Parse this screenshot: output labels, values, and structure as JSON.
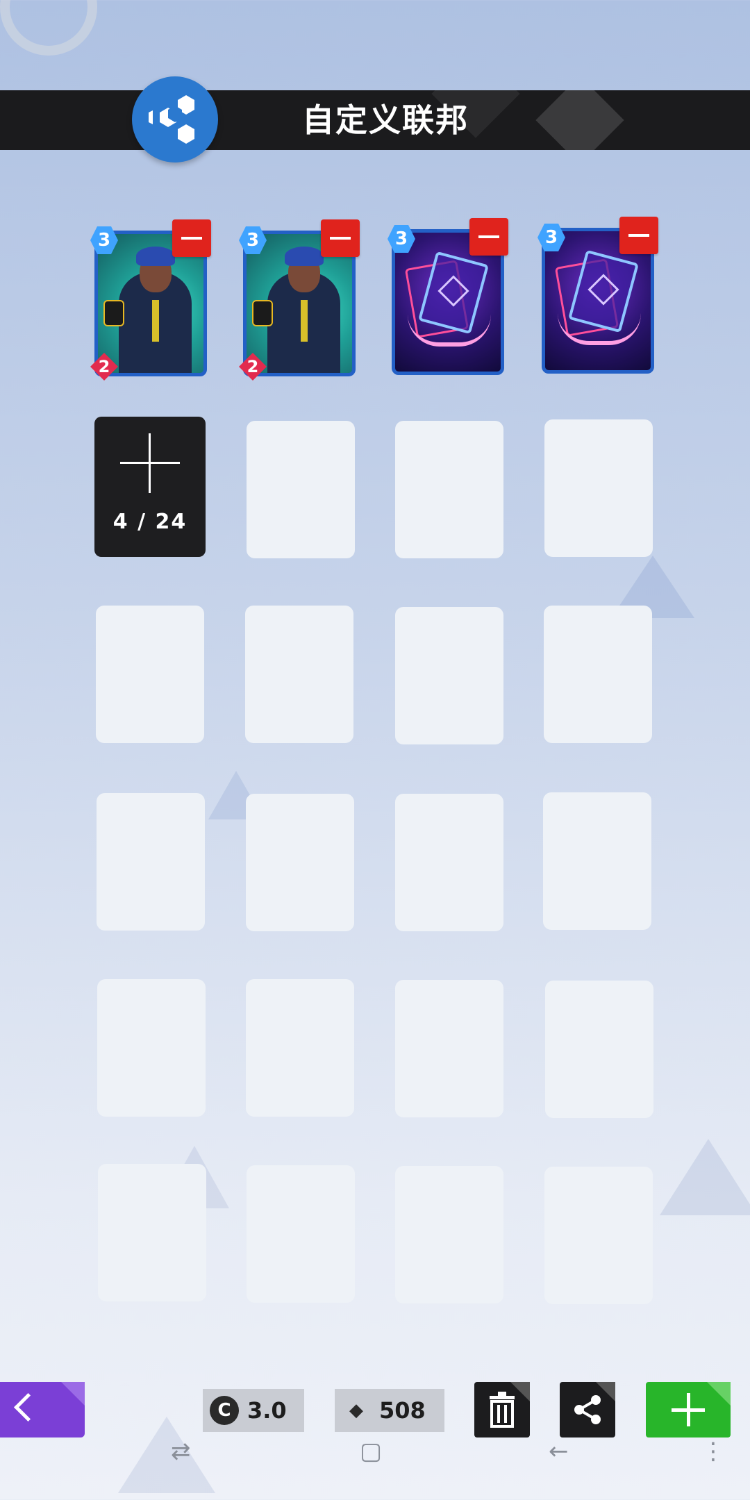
{
  "header": {
    "title": "自定义联邦",
    "logo_icon": "hexagon-molecule-icon",
    "logo_color": "#2b79cf"
  },
  "deck": {
    "cards": [
      {
        "type": "hero",
        "cost": "3",
        "power": "2"
      },
      {
        "type": "hero",
        "cost": "3",
        "power": "2"
      },
      {
        "type": "spell",
        "cost": "3"
      },
      {
        "type": "spell",
        "cost": "3"
      }
    ],
    "add_slot": {
      "count": "4 / 24"
    }
  },
  "footer": {
    "energy_icon": "energy-icon",
    "energy_avg": "3.0",
    "power_icon": "power-icon",
    "power_total": "508",
    "buttons": {
      "back": "chevron-left-icon",
      "delete": "trash-icon",
      "share": "share-icon",
      "add": "plus-icon"
    },
    "accent_colors": {
      "back": "#7b3fd6",
      "add": "#28b52a",
      "remove": "#e0231d"
    }
  },
  "system_nav": {
    "switch": "⇄",
    "home": "▢",
    "back": "←",
    "menu": "⋮"
  }
}
